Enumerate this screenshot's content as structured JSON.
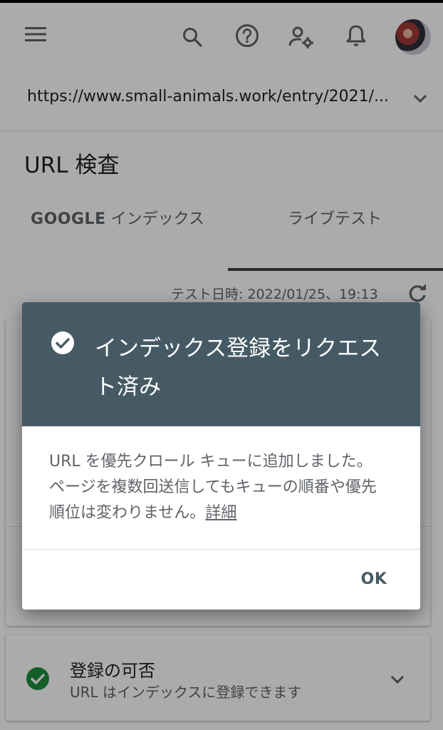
{
  "appbar": {
    "menu_icon": "menu-icon",
    "search_icon": "search-icon",
    "help_icon": "help-icon",
    "user_settings_icon": "manage-accounts-icon",
    "notifications_icon": "bell-icon",
    "avatar": "user-avatar"
  },
  "property": {
    "url": "https://www.small-animals.work/entry/2021/..."
  },
  "page": {
    "title": "URL 検査",
    "tabs": [
      {
        "label_bold": "GOOGLE",
        "label": " インデックス",
        "selected": false
      },
      {
        "label": "ライブテスト",
        "selected": true
      }
    ],
    "test_date": "テスト日時: 2022/01/25、19:13"
  },
  "cards": {
    "indexability": {
      "title": "登録の可否",
      "subtitle": "URL はインデックスに登録できます",
      "status_color": "#1e8e3e"
    }
  },
  "dialog": {
    "title": "インデックス登録をリクエスト済み",
    "body": "URL を優先クロール キューに追加しました。 ページを複数回送信してもキューの順番や優先順位は変わりません。",
    "link": "詳細",
    "ok_label": "OK",
    "header_color": "#455a64"
  }
}
